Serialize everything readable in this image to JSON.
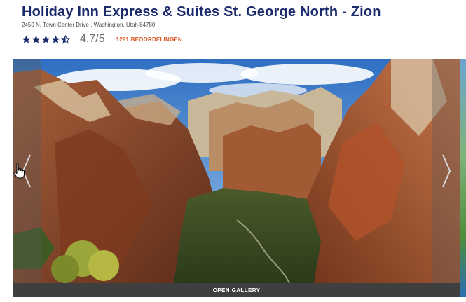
{
  "hotel": {
    "name": "Holiday Inn Express & Suites St. George North - Zion",
    "address": "2450 N. Town Center Drive , Washington, Utah 84780"
  },
  "rating": {
    "stars": 4.5,
    "max_stars": 5,
    "score_text": "4.7/5",
    "reviews_label": "1281 BEOORDELINGEN",
    "star_color": "#1b2a6b",
    "reviews_color": "#d9531e"
  },
  "gallery": {
    "open_label": "OPEN GALLERY",
    "prev_icon": "chevron-left-icon",
    "next_icon": "chevron-right-icon"
  },
  "colors": {
    "title": "#1b2a6b",
    "gallery_bar": "#3f3f3f"
  }
}
